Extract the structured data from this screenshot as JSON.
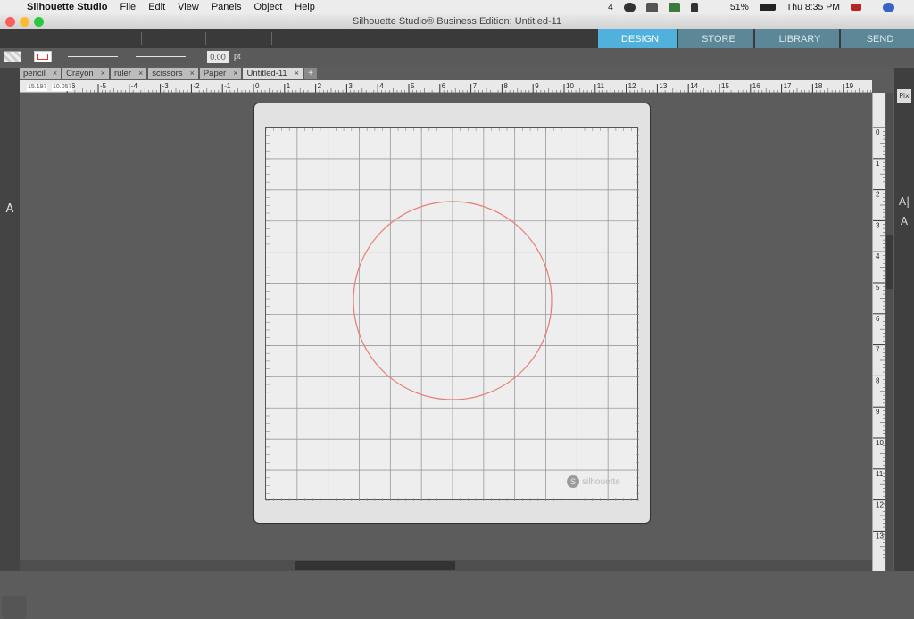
{
  "menubar": {
    "app_name": "Silhouette Studio",
    "menus": [
      "File",
      "Edit",
      "View",
      "Panels",
      "Object",
      "Help"
    ],
    "notif_count": "4",
    "battery": "51%",
    "clock": "Thu 8:35 PM"
  },
  "window": {
    "title": "Silhouette Studio® Business Edition: Untitled-11"
  },
  "nav_tabs": {
    "design": "DESIGN",
    "store": "STORE",
    "library": "LIBRARY",
    "send": "SEND"
  },
  "toolbar2": {
    "stroke_value": "0.00",
    "stroke_unit": "pt"
  },
  "doc_tabs": [
    "pencil",
    "Crayon",
    "ruler",
    "scissors",
    "Paper",
    "Untitled-11"
  ],
  "ruler": {
    "coords": [
      "15.197",
      "10.057"
    ],
    "h_labels": [
      "-6",
      "-5",
      "-4",
      "-3",
      "-2",
      "-1",
      "0",
      "1",
      "2",
      "3",
      "4",
      "5",
      "6",
      "7",
      "8",
      "9",
      "10",
      "11",
      "12",
      "13",
      "14",
      "15",
      "16",
      "17",
      "18",
      "19"
    ],
    "v_labels": [
      "0",
      "1",
      "2",
      "3",
      "4",
      "5",
      "6",
      "7",
      "8",
      "9",
      "10",
      "11",
      "12",
      "13"
    ]
  },
  "mat": {
    "brand": "silhouette"
  },
  "colors": {
    "design_tab": "#4fb1dc",
    "circle_stroke": "#e77b72"
  }
}
